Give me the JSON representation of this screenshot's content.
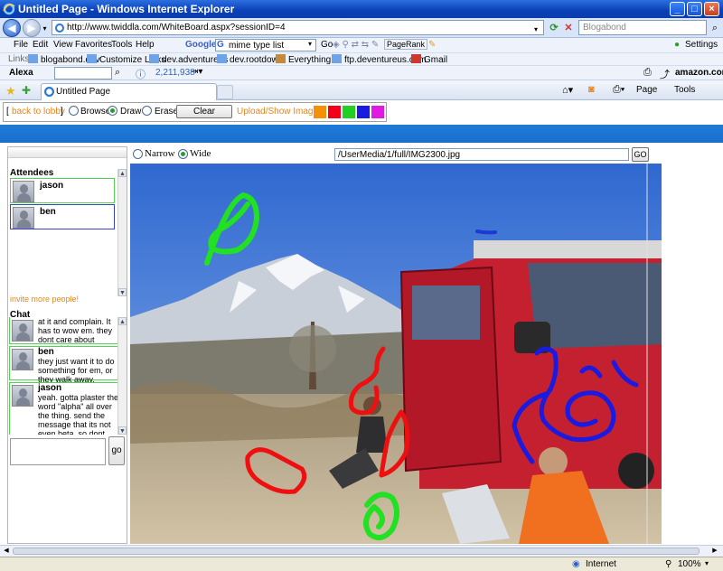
{
  "window": {
    "title": "Untitled Page - Windows Internet Explorer",
    "address": "http://www.twiddla.com/WhiteBoard.aspx?sessionID=4",
    "search_placeholder": "Blogabond"
  },
  "menu": [
    "File",
    "Edit",
    "View",
    "Favorites",
    "Tools",
    "Help"
  ],
  "google": {
    "label": "Google",
    "query": "mime type list",
    "go": "Go",
    "pagerank": "PageRank",
    "settings": "Settings"
  },
  "links": {
    "label": "Links",
    "items": [
      "blogabond.dev",
      "Customize Links",
      "dev.adventureus",
      "dev.rootdown",
      "Everything!!!",
      "ftp.deventureus.com",
      "Gmail"
    ]
  },
  "alexa": {
    "label": "Alexa",
    "rank": "2,211,938",
    "amazon": "amazon.com"
  },
  "tab": {
    "title": "Untitled Page",
    "page_menu": "Page",
    "tools_menu": "Tools"
  },
  "whiteboard": {
    "back_link": "back to lobby",
    "modes": [
      "Browse",
      "Draw",
      "Erase"
    ],
    "selected_mode": "Draw",
    "clear": "Clear",
    "upload": "Upload/Show Images",
    "colors": [
      "#f5900a",
      "#f5001a",
      "#22d022",
      "#1a1ae0",
      "#e01ae0"
    ]
  },
  "sidebar": {
    "attendees_title": "Attendees",
    "attendees": [
      "jason",
      "ben"
    ],
    "invite": "invite more people!",
    "chat_title": "Chat",
    "messages": [
      {
        "name": "",
        "text": "average people looks at it and complain.  It has to wow em. they dont care about potential"
      },
      {
        "name": "ben",
        "text": "they just want it to do something for em, or they walk away."
      },
      {
        "name": "jason",
        "text": "yeah.  gotta plaster the word \"alpha\" all over the thing.  send the message that its not even beta, so dont expect it to work at all!"
      }
    ],
    "send": "go"
  },
  "image_panel": {
    "sizes": [
      "Narrow",
      "Wide"
    ],
    "selected_size": "Wide",
    "url": "/UserMedia/1/full/IMG2300.jpg",
    "go": "GO"
  },
  "status": {
    "zone": "Internet",
    "zoom": "100%"
  }
}
